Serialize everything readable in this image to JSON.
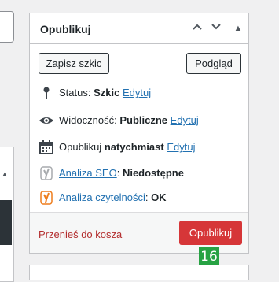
{
  "publish": {
    "title": "Opublikuj",
    "save_draft": "Zapisz szkic",
    "preview": "Podgląd",
    "status": {
      "label": "Status:",
      "value": "Szkic",
      "edit": "Edytuj"
    },
    "visibility": {
      "label": "Widoczność:",
      "value": "Publiczne",
      "edit": "Edytuj"
    },
    "schedule": {
      "label": "Opublikuj",
      "value": "natychmiast",
      "edit": "Edytuj"
    },
    "seo": {
      "link": "Analiza SEO",
      "value": "Niedostępne"
    },
    "readability": {
      "link": "Analiza czytelności",
      "value": "OK"
    },
    "trash": "Przenieś do kosza",
    "publish_button": "Opublikuj"
  },
  "badge": "16",
  "icons": {
    "collapse_up": "chevron-up-icon",
    "collapse_down": "chevron-down-icon",
    "toggle": "triangle-up-icon",
    "status": "pin-icon",
    "visibility": "eye-icon",
    "schedule": "calendar-icon",
    "seo": "yoast-icon",
    "readability": "yoast-icon"
  },
  "colors": {
    "link": "#2271b1",
    "danger": "#d63638",
    "trash": "#b32d2e",
    "badge": "#27a243",
    "seo_icon": "#a7aaad",
    "readability_icon": "#ee7c1b"
  }
}
